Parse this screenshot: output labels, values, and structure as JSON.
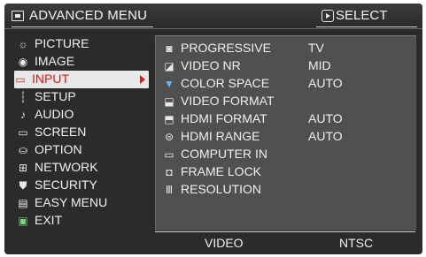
{
  "header": {
    "title": "ADVANCED MENU",
    "select_label": "SELECT"
  },
  "left_menu": {
    "items": [
      {
        "label": "PICTURE",
        "icon": "picture-icon"
      },
      {
        "label": "IMAGE",
        "icon": "image-icon"
      },
      {
        "label": "INPUT",
        "icon": "input-icon"
      },
      {
        "label": "SETUP",
        "icon": "setup-icon"
      },
      {
        "label": "AUDIO",
        "icon": "audio-icon"
      },
      {
        "label": "SCREEN",
        "icon": "screen-icon"
      },
      {
        "label": "OPTION",
        "icon": "option-icon"
      },
      {
        "label": "NETWORK",
        "icon": "network-icon"
      },
      {
        "label": "SECURITY",
        "icon": "security-icon"
      },
      {
        "label": "EASY MENU",
        "icon": "easy-menu-icon"
      },
      {
        "label": "EXIT",
        "icon": "exit-icon"
      }
    ],
    "active": "INPUT"
  },
  "input_menu": {
    "items": [
      {
        "label": "PROGRESSIVE",
        "value": "TV",
        "icon": "progressive-icon"
      },
      {
        "label": "VIDEO NR",
        "value": "MID",
        "icon": "video-nr-icon"
      },
      {
        "label": "COLOR SPACE",
        "value": "AUTO",
        "icon": "color-space-icon"
      },
      {
        "label": "VIDEO FORMAT",
        "value": "",
        "icon": "video-format-icon"
      },
      {
        "label": "HDMI FORMAT",
        "value": "AUTO",
        "icon": "hdmi-format-icon"
      },
      {
        "label": "HDMI RANGE",
        "value": "AUTO",
        "icon": "hdmi-range-icon"
      },
      {
        "label": "COMPUTER IN",
        "value": "",
        "icon": "computer-in-icon"
      },
      {
        "label": "FRAME LOCK",
        "value": "",
        "icon": "frame-lock-icon"
      },
      {
        "label": "RESOLUTION",
        "value": "",
        "icon": "resolution-icon"
      }
    ]
  },
  "status": {
    "source": "VIDEO",
    "signal": "NTSC"
  },
  "colors": {
    "active_bg": "#e8e8e8",
    "active_text": "#cc1f1f",
    "panel_bg": "#505050",
    "osd_bg": "#2b2b2b"
  }
}
